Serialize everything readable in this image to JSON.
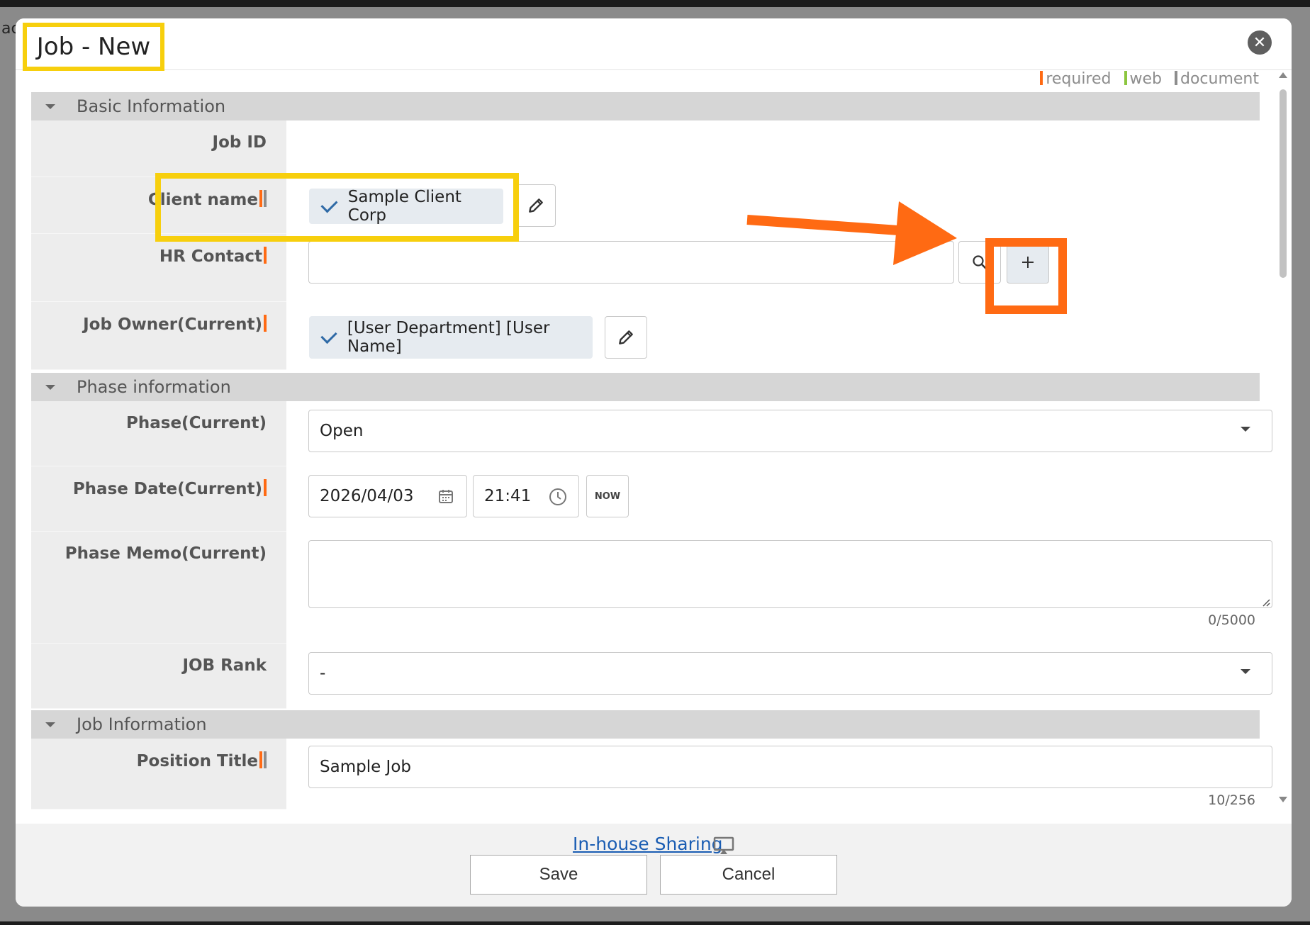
{
  "modal": {
    "title": "Job - New"
  },
  "legend": {
    "required": "required",
    "web": "web",
    "document": "document",
    "colors": {
      "required": "#ff6a13",
      "web": "#8cc63f",
      "document": "#8d8d8d"
    }
  },
  "sections": {
    "basic": "Basic Information",
    "phase": "Phase information",
    "job": "Job Information"
  },
  "fields": {
    "job_id": {
      "label": "Job ID"
    },
    "client_name": {
      "label": "Client name",
      "value": "Sample Client Corp"
    },
    "hr_contact": {
      "label": "HR Contact",
      "value": ""
    },
    "job_owner": {
      "label": "Job Owner(Current)",
      "value": "[User Department] [User Name]"
    },
    "phase": {
      "label": "Phase(Current)",
      "value": "Open"
    },
    "phase_date": {
      "label": "Phase Date(Current)",
      "date": "2026/04/03",
      "time": "21:41",
      "now_label": "NOW"
    },
    "phase_memo": {
      "label": "Phase Memo(Current)",
      "value": "",
      "counter": "0/5000"
    },
    "job_rank": {
      "label": "JOB Rank",
      "value": "-"
    },
    "position_title": {
      "label": "Position Title",
      "value": "Sample Job",
      "counter": "10/256"
    }
  },
  "footer": {
    "share_link": "In-house Sharing",
    "save": "Save",
    "cancel": "Cancel"
  },
  "annotations": {
    "highlight_color": "#f7cf0d",
    "arrow_color": "#ff6a13"
  }
}
